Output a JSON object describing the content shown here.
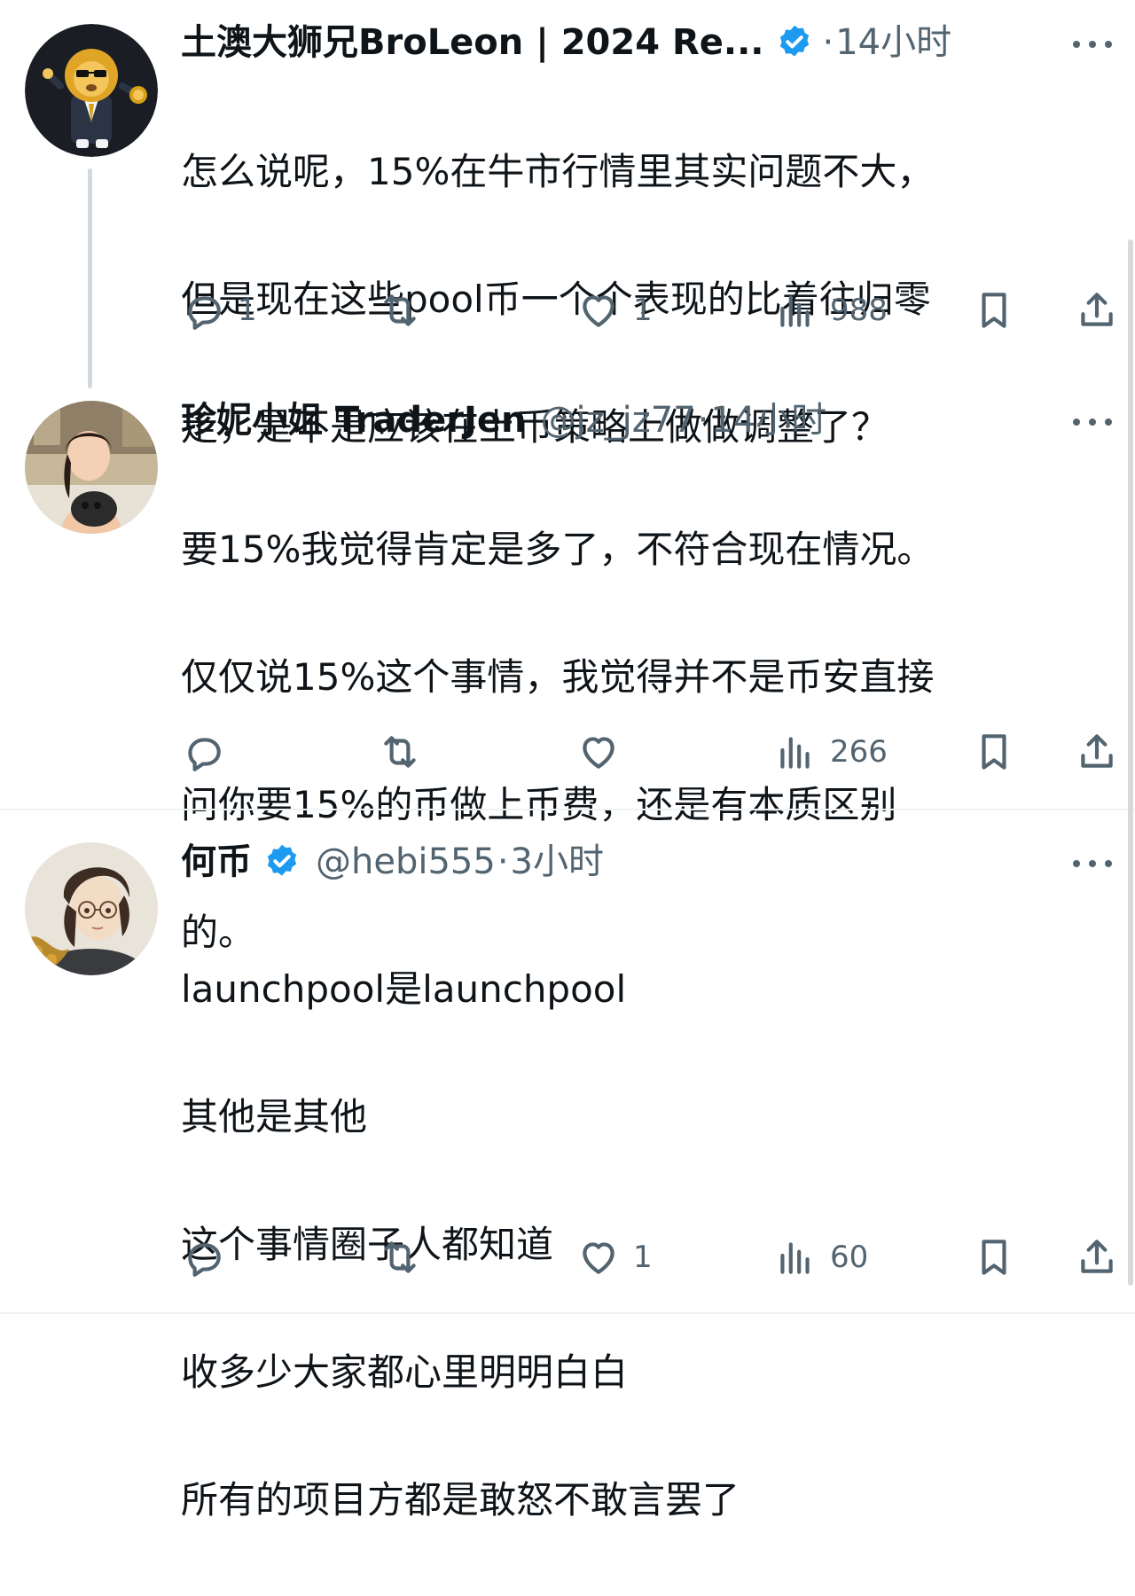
{
  "tweets": [
    {
      "name": "土澳大狮兄BroLeon | 2024 Re...",
      "verified": true,
      "handle": "",
      "separator": "·",
      "time": "14小时",
      "lines": [
        "怎么说呢，15%在牛市行情里其实问题不大，",
        "但是现在这些pool币一个个表现的比着往归零",
        "走，是不是应该在上币策略上做做调整了？"
      ],
      "replies": "1",
      "retweets": "",
      "likes": "1",
      "views": "988"
    },
    {
      "name": "珍妮小姐 TraderJen",
      "verified": false,
      "handle": "@jz_jz77",
      "separator": "·",
      "time": "14小时",
      "lines": [
        "要15%我觉得肯定是多了，不符合现在情况。",
        "仅仅说15%这个事情，我觉得并不是币安直接",
        "问你要15%的币做上币费，还是有本质区别",
        "的。"
      ],
      "replies": "",
      "retweets": "",
      "likes": "",
      "views": "266"
    },
    {
      "name": "何币",
      "verified": true,
      "handle": "@hebi555",
      "separator": "·",
      "time": "3小时",
      "lines": [
        "launchpool是launchpool",
        "其他是其他",
        "这个事情圈子人都知道",
        "收多少大家都心里明明白白",
        "所有的项目方都是敢怒不敢言罢了"
      ],
      "replies": "",
      "retweets": "",
      "likes": "1",
      "views": "60"
    }
  ],
  "colors": {
    "text": "#0f1419",
    "secondary": "#536471",
    "verified": "#1d9bf0",
    "thread_line": "#cfd9de",
    "divider": "#eff3f4"
  },
  "icons": [
    "reply-icon",
    "retweet-icon",
    "like-icon",
    "views-icon",
    "bookmark-icon",
    "share-icon",
    "more-icon",
    "verified-badge-icon"
  ]
}
